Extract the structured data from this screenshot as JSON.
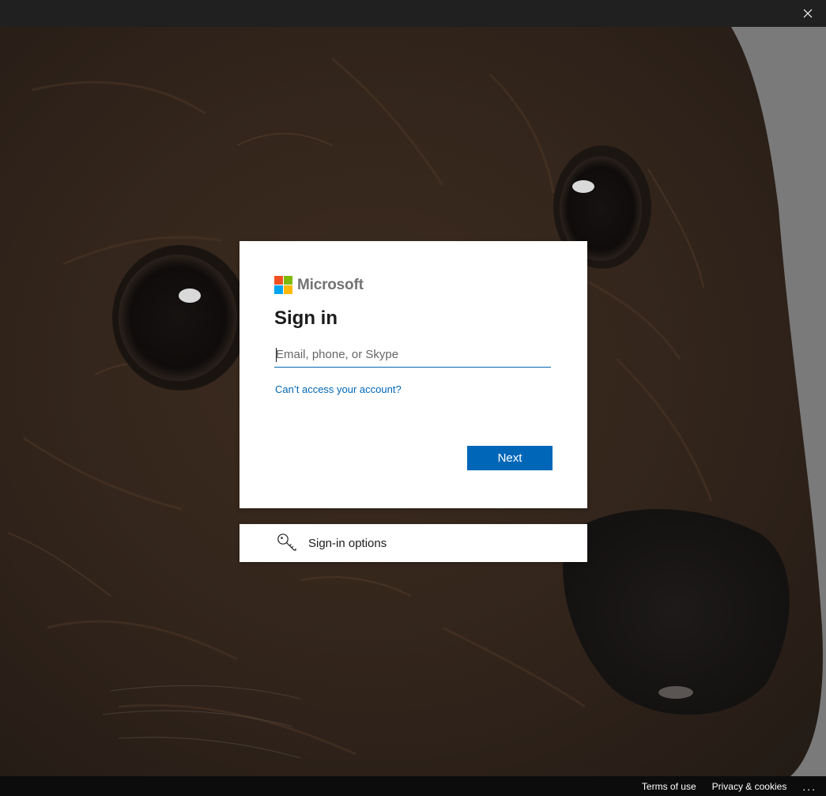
{
  "brand": {
    "name": "Microsoft",
    "logo_colors": [
      "#f25022",
      "#7fba00",
      "#00a4ef",
      "#ffb900"
    ]
  },
  "signin": {
    "title": "Sign in",
    "email_placeholder": "Email, phone, or Skype",
    "email_value": "",
    "cant_access_link": "Can’t access your account?",
    "next_label": "Next"
  },
  "options": {
    "label": "Sign-in options",
    "icon": "key-icon"
  },
  "footer": {
    "terms": "Terms of use",
    "privacy": "Privacy & cookies",
    "more": "..."
  },
  "window": {
    "close_icon": "close-icon"
  },
  "colors": {
    "accent": "#0067b8",
    "card_bg": "#ffffff",
    "titlebar_bg": "#202020"
  }
}
